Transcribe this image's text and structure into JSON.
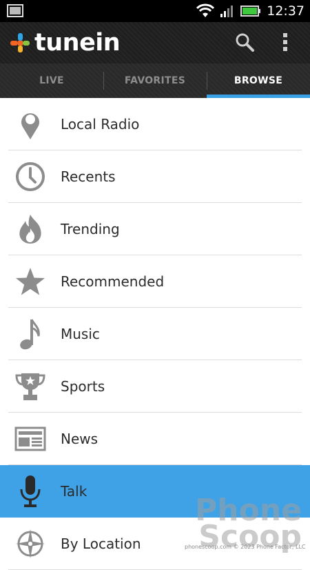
{
  "status_bar": {
    "time": "12:37",
    "icons": [
      "image-thumbnail-icon",
      "wifi-icon",
      "signal-icon",
      "battery-icon"
    ],
    "battery_color": "#3ec83e"
  },
  "app_bar": {
    "logo_text": "tunein",
    "logo_colors": {
      "top": "#2fa4e7",
      "left": "#f26522",
      "right": "#8ac440",
      "bottom": "#f7b32b"
    },
    "actions": [
      "search-icon",
      "overflow-menu-icon"
    ]
  },
  "tabs": [
    {
      "label": "LIVE",
      "active": false
    },
    {
      "label": "FAVORITES",
      "active": false
    },
    {
      "label": "BROWSE",
      "active": true
    }
  ],
  "accent_color": "#3aa0e6",
  "browse_items": [
    {
      "label": "Local Radio",
      "icon": "location-pin-icon",
      "selected": false
    },
    {
      "label": "Recents",
      "icon": "clock-icon",
      "selected": false
    },
    {
      "label": "Trending",
      "icon": "fire-icon",
      "selected": false
    },
    {
      "label": "Recommended",
      "icon": "star-icon",
      "selected": false
    },
    {
      "label": "Music",
      "icon": "music-note-icon",
      "selected": false
    },
    {
      "label": "Sports",
      "icon": "trophy-icon",
      "selected": false
    },
    {
      "label": "News",
      "icon": "newspaper-icon",
      "selected": false
    },
    {
      "label": "Talk",
      "icon": "microphone-icon",
      "selected": true
    },
    {
      "label": "By Location",
      "icon": "compass-icon",
      "selected": false
    }
  ],
  "watermark": {
    "line1": "Phone",
    "line2": "Scoop",
    "credit": "phonescoop.com   © 2023 Phone Factor, LLC"
  }
}
